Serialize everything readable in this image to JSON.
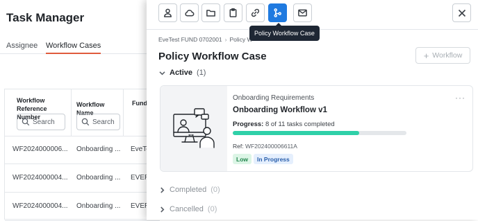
{
  "background": {
    "title": "Task Manager",
    "tabs": [
      "Assignee",
      "Workflow Cases"
    ],
    "columns": [
      {
        "label": "Workflow Reference Number",
        "search": "Search"
      },
      {
        "label": "Workflow Name",
        "search": "Search"
      },
      {
        "label": "Fund"
      }
    ],
    "rows": [
      [
        "WF2024000006...",
        "Onboarding ...",
        "EveTe"
      ],
      [
        "WF2024000004...",
        "Onboarding ...",
        "EVER"
      ],
      [
        "WF2024000004...",
        "Onboarding ...",
        "EVER"
      ]
    ]
  },
  "toolbar": {
    "icons": [
      "user-icon",
      "cloud-icon",
      "folder-icon",
      "clipboard-icon",
      "link-icon",
      "workflow-icon",
      "mail-icon"
    ],
    "active_index": 5,
    "tooltip": "Policy Workflow Case",
    "accent_color": "#1f7ae0"
  },
  "breadcrumb": [
    "EveTest FUND 0702001",
    "Policy W"
  ],
  "page_title": "Policy Workflow Case",
  "workflow_button": "Workflow",
  "sections": {
    "active": {
      "label": "Active",
      "count": "(1)"
    },
    "completed": {
      "label": "Completed",
      "count": "(0)"
    },
    "cancelled": {
      "label": "Cancelled",
      "count": "(0)"
    }
  },
  "card": {
    "category": "Onboarding Requirements",
    "menu": "···",
    "title": "Onboarding Workflow v1",
    "progress_label": "Progress:",
    "progress_value": "8 of 11 tasks completed",
    "progress_fraction": 0.727,
    "ref_label": "Ref:",
    "ref_value": "WF202400006611A",
    "priority": "Low",
    "status": "In Progress",
    "progress_color": "#2fd0a8"
  }
}
